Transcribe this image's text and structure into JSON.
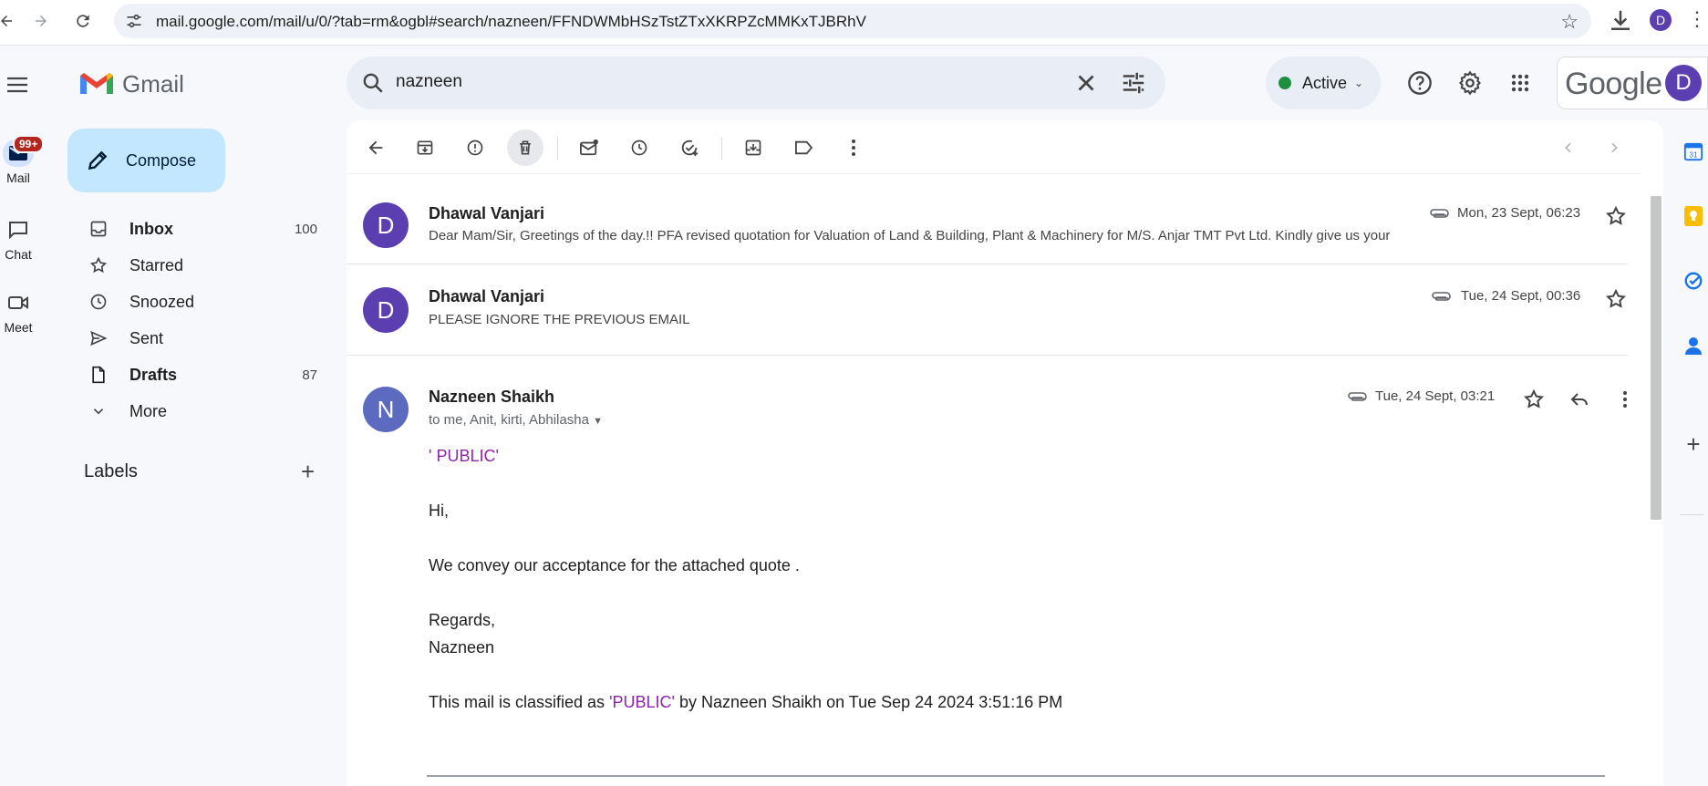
{
  "browser": {
    "url": "mail.google.com/mail/u/0/?tab=rm&ogbl#search/nazneen/FFNDWMbHSzTstZTxXKRPZcMMKxTJBRhV",
    "profile_initial": "D"
  },
  "rail": {
    "mail_label": "Mail",
    "badge": "99+",
    "chat_label": "Chat",
    "meet_label": "Meet"
  },
  "logo": {
    "text": "Gmail"
  },
  "search": {
    "query": "nazneen"
  },
  "status": {
    "label": "Active",
    "color": "#1e8e3e"
  },
  "account": {
    "brand": "Google",
    "initial": "D"
  },
  "compose": {
    "label": "Compose"
  },
  "nav": {
    "items": [
      {
        "label": "Inbox",
        "count": "100",
        "icon": "inbox-icon"
      },
      {
        "label": "Starred",
        "count": "",
        "icon": "star-icon"
      },
      {
        "label": "Snoozed",
        "count": "",
        "icon": "clock-icon"
      },
      {
        "label": "Sent",
        "count": "",
        "icon": "send-icon"
      },
      {
        "label": "Drafts",
        "count": "87",
        "icon": "draft-icon"
      },
      {
        "label": "More",
        "count": "",
        "icon": "chevron-down-icon"
      }
    ],
    "labels_heading": "Labels"
  },
  "messages": [
    {
      "sender": "Dhawal Vanjari",
      "initial": "D",
      "avatar_color": "#5b3fb0",
      "date": "Mon, 23 Sept, 06:23",
      "snippet": "Dear Mam/Sir, Greetings of the day.!! PFA revised quotation for Valuation of Land & Building, Plant & Machinery for M/S. Anjar TMT Pvt Ltd. Kindly give us your"
    },
    {
      "sender": "Dhawal Vanjari",
      "initial": "D",
      "avatar_color": "#5b3fb0",
      "date": "Tue, 24 Sept, 00:36",
      "snippet": "PLEASE IGNORE THE PREVIOUS EMAIL"
    }
  ],
  "open_message": {
    "sender": "Nazneen Shaikh",
    "initial": "N",
    "avatar_color": "#5c6bc0",
    "date": "Tue, 24 Sept, 03:21",
    "recipients": "to me, Anit, kirti, Abhilasha",
    "classification_tag": "' PUBLIC'",
    "greeting": "Hi,",
    "body": "We convey our acceptance for the attached quote .",
    "signoff": "Regards,",
    "signature": "Nazneen",
    "footer_prefix": "This mail is classified as ",
    "footer_tag": "'PUBLIC'",
    "footer_suffix": " by Nazneen Shaikh on Tue Sep 24 2024 3:51:16 PM"
  },
  "colors": {
    "accent": "#0b57d0",
    "compose_bg": "#c2e7ff",
    "public_tag": "#8e24aa"
  }
}
